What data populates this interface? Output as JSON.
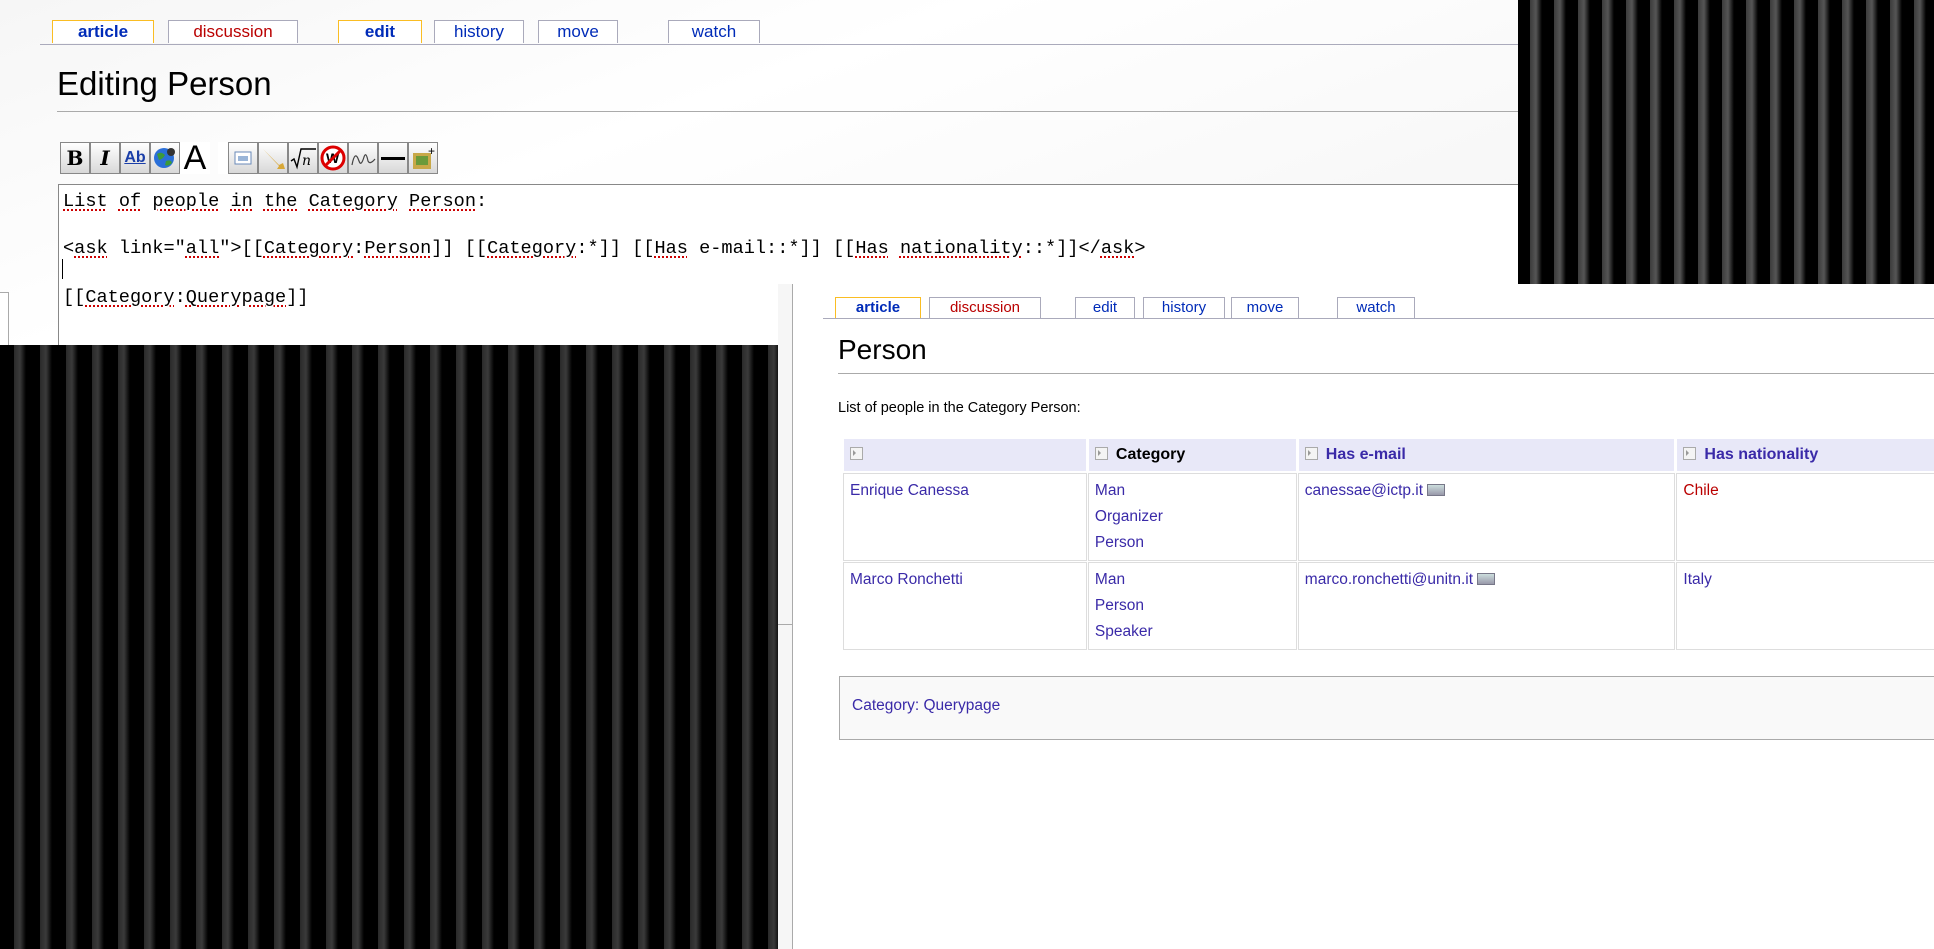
{
  "edit_window": {
    "tabs": [
      {
        "label": "article"
      },
      {
        "label": "discussion"
      },
      {
        "label": "edit"
      },
      {
        "label": "history"
      },
      {
        "label": "move"
      },
      {
        "label": "watch"
      }
    ],
    "title": "Editing Person",
    "toolbar": {
      "bold": "B",
      "italic": "I",
      "link": "Ab",
      "headline": "A"
    },
    "textarea": {
      "line1_a": "List",
      "line1_b": "of",
      "line1_c": "people",
      "line1_d": "in",
      "line1_e": "the",
      "line1_f": "Category",
      "line1_g": "Person",
      "line1_h": ":",
      "line2_a": "<",
      "line2_b": "ask",
      "line2_c": " link=\"",
      "line2_d": "all",
      "line2_e": "\">[[",
      "line2_f": "Category",
      "line2_g": ":",
      "line2_h": "Person",
      "line2_i": "]] [[",
      "line2_j": "Category",
      "line2_k": ":*]] [[",
      "line2_l": "Has",
      "line2_m": " e-mail::*]] [[",
      "line2_n": "Has",
      "line2_o": " ",
      "line2_p": "nationality",
      "line2_q": "::*]]</",
      "line2_r": "ask",
      "line2_s": ">",
      "line3_a": "[[",
      "line3_b": "Category",
      "line3_c": ":",
      "line3_d": "Querypage",
      "line3_e": "]]"
    }
  },
  "result_window": {
    "tabs": [
      {
        "label": "article"
      },
      {
        "label": "discussion"
      },
      {
        "label": "edit"
      },
      {
        "label": "history"
      },
      {
        "label": "move"
      },
      {
        "label": "watch"
      }
    ],
    "title": "Person",
    "intro": "List of people in the Category Person:",
    "table": {
      "headers": [
        "",
        "Category",
        "Has e-mail",
        "Has nationality"
      ],
      "rows": [
        {
          "name": "Enrique Canessa",
          "categories": [
            "Man",
            "Organizer",
            "Person"
          ],
          "email": "canessae@ictp.it",
          "nationality": "Chile"
        },
        {
          "name": "Marco Ronchetti",
          "categories": [
            "Man",
            "Person",
            "Speaker"
          ],
          "email": "marco.ronchetti@unitn.it",
          "nationality": "Italy"
        }
      ]
    },
    "category_footer": "Category: Querypage"
  },
  "colors": {
    "link": "#3a2aa8",
    "redlink": "#ba0000",
    "selected_tab_border": "#fabd23"
  }
}
